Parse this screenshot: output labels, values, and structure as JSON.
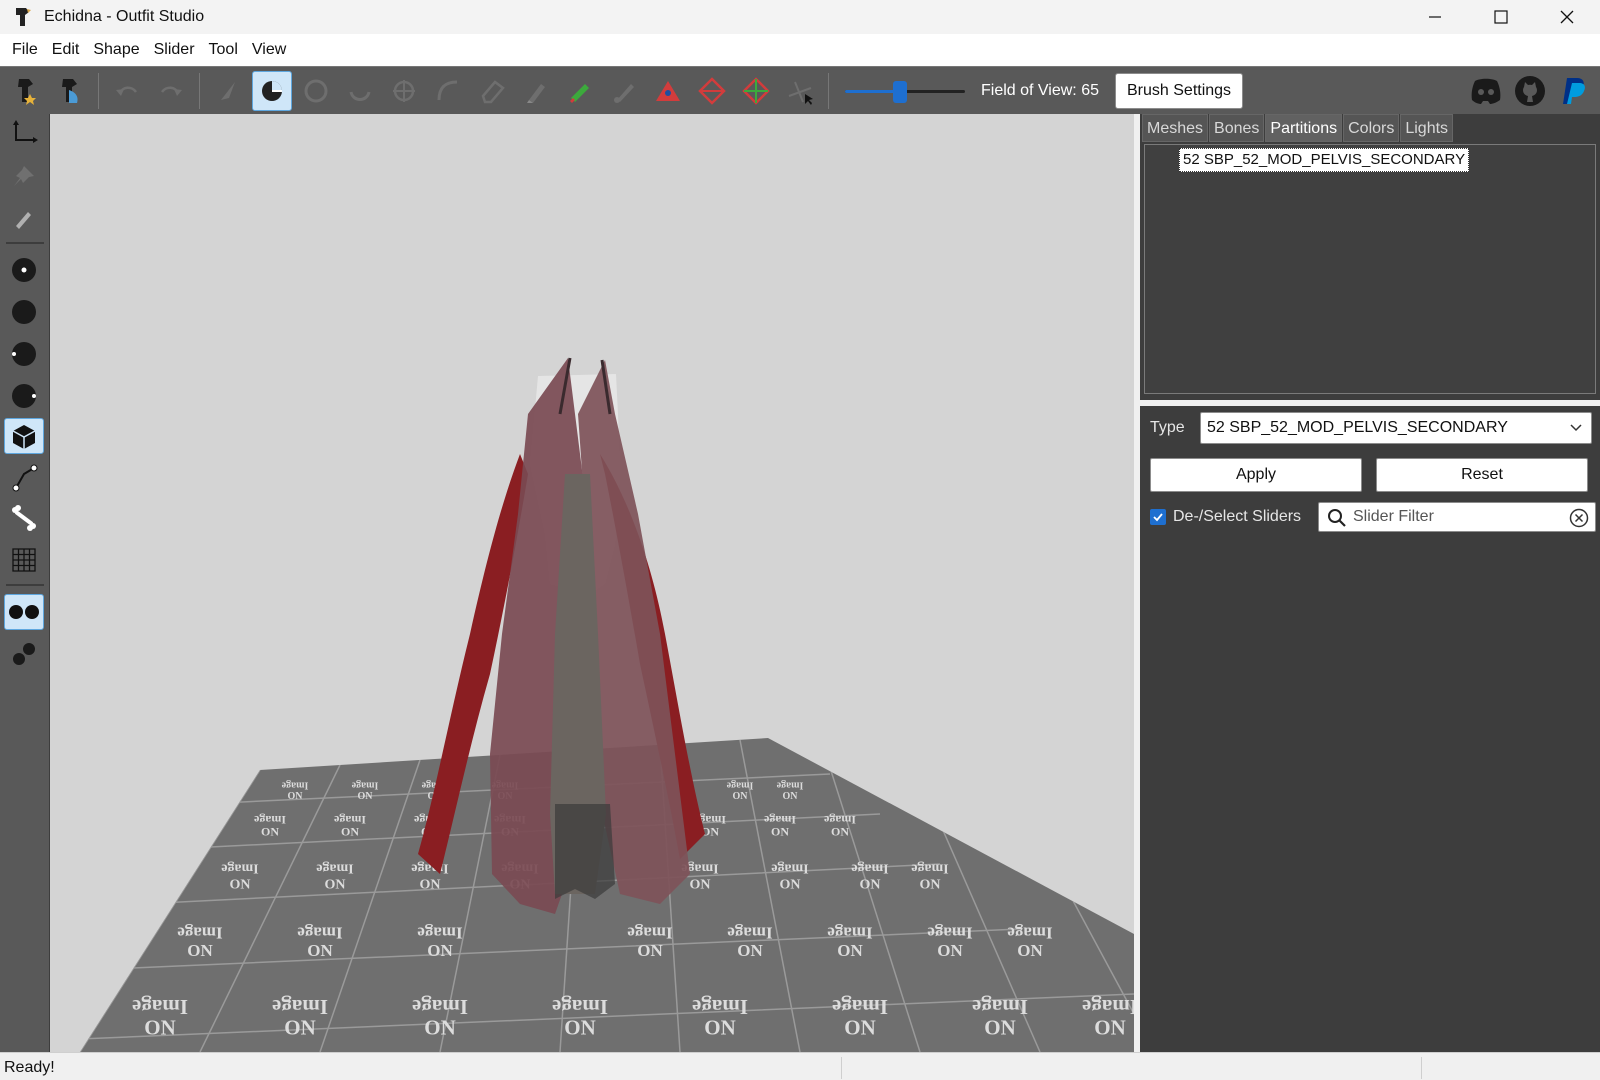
{
  "window": {
    "title": "Echidna - Outfit Studio"
  },
  "menu": [
    "File",
    "Edit",
    "Shape",
    "Slider",
    "Tool",
    "View"
  ],
  "toolbar": {
    "field_of_view_label": "Field of View: 65",
    "field_of_view_level": 0.45,
    "brush_settings_label": "Brush Settings"
  },
  "panel": {
    "tabs": [
      "Meshes",
      "Bones",
      "Partitions",
      "Colors",
      "Lights"
    ],
    "active_tab": "Partitions",
    "partition_item": "52 SBP_52_MOD_PELVIS_SECONDARY",
    "type_label": "Type",
    "type_value": "52 SBP_52_MOD_PELVIS_SECONDARY",
    "apply_label": "Apply",
    "reset_label": "Reset",
    "deselect_label": "De-/Select Sliders",
    "deselect_checked": true,
    "slider_filter_placeholder": "Slider Filter"
  },
  "viewport": {
    "floor_tile_text_top": "Image",
    "floor_tile_text_bottom": "ON"
  },
  "status": {
    "text": "Ready!"
  },
  "colors": {
    "toolbar_bg": "#595959",
    "viewport_bg": "#d4d4d4",
    "panel_bg": "#3d3d3d",
    "accent": "#1e6fd0"
  }
}
